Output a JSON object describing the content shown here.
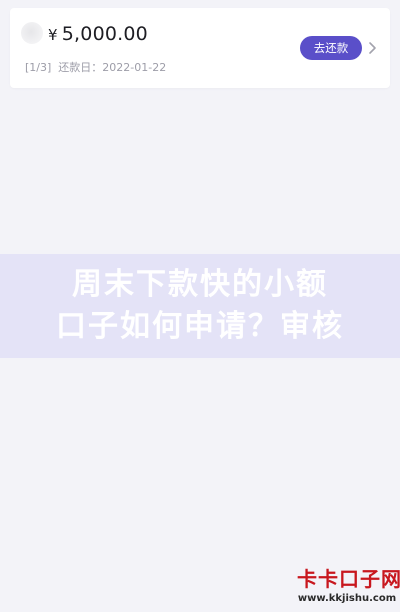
{
  "loan": {
    "logo": "app-logo",
    "currency": "¥",
    "amount": "5,000.00",
    "installment": "[1/3]",
    "due_label": "还款日：",
    "due_date": "2022-01-22",
    "repay_label": "去还款",
    "chevron_icon": "chevron-right-icon"
  },
  "overlay": {
    "title_line1": "周末下款快的小额",
    "title_line2": "口子如何申请？审核"
  },
  "watermark": {
    "text": "卡卡口子网",
    "url": "www.kkjishu.com"
  },
  "colors": {
    "background": "#f3f3f8",
    "card": "#ffffff",
    "accent": "#5a4fc9",
    "overlay_band": "#e4e3f7",
    "watermark_red": "#c8171e"
  }
}
